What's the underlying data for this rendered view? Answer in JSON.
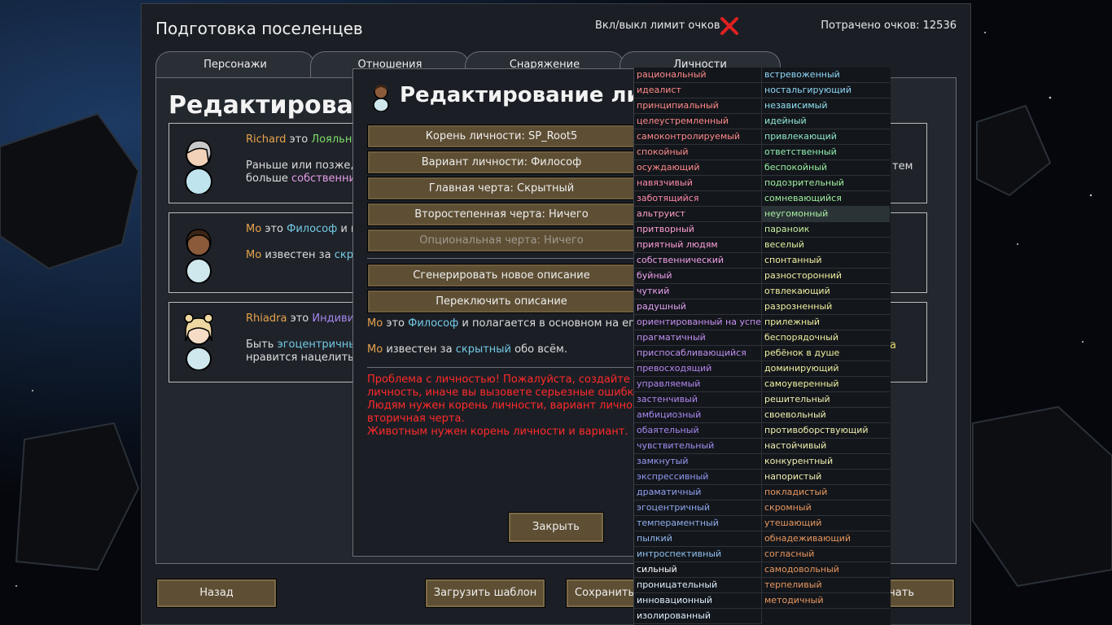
{
  "header": {
    "title": "Подготовка поселенцев",
    "limit_toggle_label": "Вкл/выкл лимит очков",
    "points_spent": "Потрачено очков: 12536"
  },
  "tabs": [
    "Персонажи",
    "Отношения",
    "Снаряжение",
    "Личности"
  ],
  "main": {
    "title_visible": "Редактироват",
    "cards": [
      {
        "name": "Richard",
        "is": "это",
        "role": "Лояльны",
        "line2a": "Раньше или позже,",
        "line3a": "больше",
        "line3b": "собственнич",
        "right_fragment": "тем"
      },
      {
        "name": "Мо",
        "is": "это",
        "role": "Философ",
        "role_tail": "и г",
        "line2a": "Мо",
        "line2b": "известен за",
        "line2c": "скр"
      },
      {
        "name": "Rhiadra",
        "is": "это",
        "role": "Индивид",
        "line2a": "Быть",
        "line2b": "эгоцентричный",
        "line3a": "нравится нацелить",
        "right_fragment": "а"
      }
    ]
  },
  "bottom_buttons": {
    "back": "Назад",
    "load_template": "Загрузить шаблон",
    "save": "Сохранить",
    "start": "чать"
  },
  "modal": {
    "title": "Редактирование личн",
    "buttons": [
      {
        "label": "Корень личности: SP_Root5",
        "disabled": false
      },
      {
        "label": "Вариант личности: Философ",
        "disabled": false
      },
      {
        "label": "Главная черта: Скрытный",
        "disabled": false
      },
      {
        "label": "Второстепенная черта: Ничего",
        "disabled": false
      },
      {
        "label": "Опциональная черта: Ничего",
        "disabled": true
      }
    ],
    "generate_label": "Сгенерировать новое описание",
    "switch_label": "Переключить описание",
    "desc1": {
      "name": "Мо",
      "is": "это",
      "role": "Философ",
      "rest": "и полагается в основном на его"
    },
    "desc2": {
      "name": "Мо",
      "mid": "известен за",
      "trait": "скрытный",
      "rest": "обо всём."
    },
    "error_lines": [
      "Проблема с личностью! Пожалуйста, создайте де",
      "личность, иначе вы вызовете серьезные ошибки!",
      "Людям нужен корень личности, вариант личност",
      "вторичная черта.",
      "Животным нужен корень личности и вариант."
    ],
    "close_label": "Закрыть"
  },
  "traits": {
    "left": [
      {
        "t": "рациональный",
        "c": "#ff8a8a"
      },
      {
        "t": "идеалист",
        "c": "#ff8a8a"
      },
      {
        "t": "принципиальный",
        "c": "#ff8a8a"
      },
      {
        "t": "целеустремленный",
        "c": "#ff8a8a"
      },
      {
        "t": "самоконтролируемый",
        "c": "#ff8a8a"
      },
      {
        "t": "спокойный",
        "c": "#ff8a8a"
      },
      {
        "t": "осуждающий",
        "c": "#ff8a8a"
      },
      {
        "t": "навязчивый",
        "c": "#ff8aa8"
      },
      {
        "t": "заботящийся",
        "c": "#ff8aa8"
      },
      {
        "t": "альтруист",
        "c": "#ffa0c8"
      },
      {
        "t": "притворный",
        "c": "#ffa0d0"
      },
      {
        "t": "приятный людям",
        "c": "#ffa0d8"
      },
      {
        "t": "собственнический",
        "c": "#f0a0e8"
      },
      {
        "t": "буйный",
        "c": "#f0a0f0"
      },
      {
        "t": "чуткий",
        "c": "#e8a0f0"
      },
      {
        "t": "радушный",
        "c": "#e0a0f0"
      },
      {
        "t": "ориентированный на успех",
        "c": "#c890f0"
      },
      {
        "t": "прагматичный",
        "c": "#c090f0"
      },
      {
        "t": "приспосабливающийся",
        "c": "#c090f0"
      },
      {
        "t": "превосходящий",
        "c": "#b888f0"
      },
      {
        "t": "управляемый",
        "c": "#b088f0"
      },
      {
        "t": "застенчивый",
        "c": "#b088f0"
      },
      {
        "t": "амбициозный",
        "c": "#a888f0"
      },
      {
        "t": "обаятельный",
        "c": "#a888f0"
      },
      {
        "t": "чувствительный",
        "c": "#a090f0"
      },
      {
        "t": "замкнутый",
        "c": "#9898f0"
      },
      {
        "t": "экспрессивный",
        "c": "#9098f0"
      },
      {
        "t": "драматичный",
        "c": "#90a0f0"
      },
      {
        "t": "эгоцентричный",
        "c": "#90a8f0"
      },
      {
        "t": "темпераментный",
        "c": "#90b0f0"
      },
      {
        "t": "пылкий",
        "c": "#90b8f0"
      },
      {
        "t": "интроспективный",
        "c": "#90c0f0"
      },
      {
        "t": "сильный",
        "c": "#ffffff"
      },
      {
        "t": "проницательный",
        "c": "#e0f0ff"
      },
      {
        "t": "инновационный",
        "c": "#e0f0ff"
      },
      {
        "t": "изолированный",
        "c": "#e0f0ff"
      }
    ],
    "right": [
      {
        "t": "встревоженный",
        "c": "#90d8f8"
      },
      {
        "t": "ностальгирующий",
        "c": "#90d8f8"
      },
      {
        "t": "независимый",
        "c": "#90e0f0"
      },
      {
        "t": "идейный",
        "c": "#90e8d8"
      },
      {
        "t": "привлекающий",
        "c": "#90e8c8"
      },
      {
        "t": "ответственный",
        "c": "#90f0b0"
      },
      {
        "t": "беспокойный",
        "c": "#98f0a0"
      },
      {
        "t": "подозрительный",
        "c": "#a0f0a0"
      },
      {
        "t": "сомневающийся",
        "c": "#a0f0a0"
      },
      {
        "t": "неугомонный",
        "c": "#a8f0a0"
      },
      {
        "t": "параноик",
        "c": "#c8f0a0"
      },
      {
        "t": "веселый",
        "c": "#e0f0a0"
      },
      {
        "t": "спонтанный",
        "c": "#f0f0a0"
      },
      {
        "t": "разносторонний",
        "c": "#f0f0a0"
      },
      {
        "t": "отвлекающий",
        "c": "#f0f0a0"
      },
      {
        "t": "разрозненный",
        "c": "#f0f0a0"
      },
      {
        "t": "прилежный",
        "c": "#f0f0a0"
      },
      {
        "t": "беспорядочный",
        "c": "#f0f0a0"
      },
      {
        "t": "ребёнок в душе",
        "c": "#f0f0a0"
      },
      {
        "t": "доминирующий",
        "c": "#f0f0a0"
      },
      {
        "t": "самоуверенный",
        "c": "#f0f0a0"
      },
      {
        "t": "решительный",
        "c": "#f0f0b0"
      },
      {
        "t": "своевольный",
        "c": "#f0f0b0"
      },
      {
        "t": "противоборствующий",
        "c": "#f0f0b0"
      },
      {
        "t": "настойчивый",
        "c": "#f0f0b0"
      },
      {
        "t": "конкурентный",
        "c": "#f0f0b0"
      },
      {
        "t": "напористый",
        "c": "#f0f0b0"
      },
      {
        "t": "покладистый",
        "c": "#e89860"
      },
      {
        "t": "скромный",
        "c": "#e89860"
      },
      {
        "t": "утешающий",
        "c": "#e89860"
      },
      {
        "t": "обнадеживающий",
        "c": "#e89860"
      },
      {
        "t": "согласный",
        "c": "#e89860"
      },
      {
        "t": "самодовольный",
        "c": "#e89860"
      },
      {
        "t": "терпеливый",
        "c": "#e89860"
      },
      {
        "t": "методичный",
        "c": "#e89860"
      }
    ],
    "highlighted": "неугомонный"
  },
  "colors": {
    "accent_orange": "#e8a24c",
    "button_brown": "#5e4f34",
    "error_red": "#ff2a2a",
    "close_x_red": "#e02020"
  }
}
